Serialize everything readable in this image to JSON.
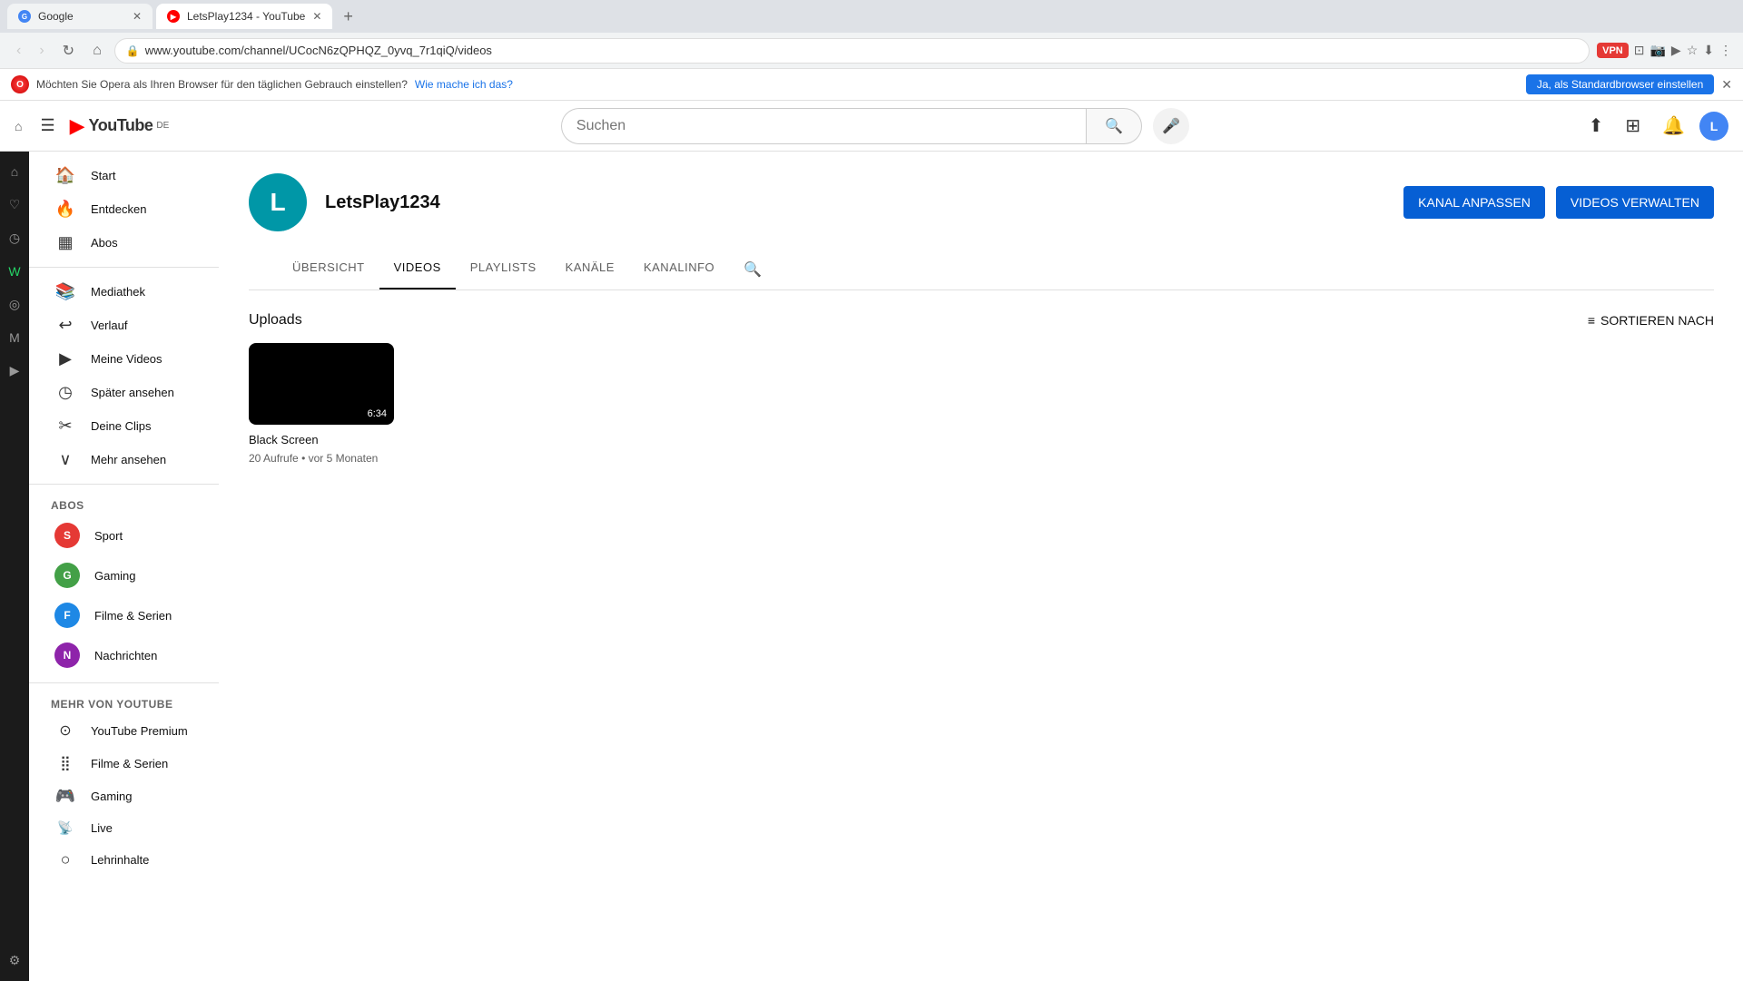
{
  "browser": {
    "tabs": [
      {
        "id": "google",
        "title": "Google",
        "favicon": "G",
        "favicon_type": "google",
        "active": false
      },
      {
        "id": "youtube",
        "title": "LetsPlay1234 - YouTube",
        "favicon": "YT",
        "favicon_type": "yt",
        "active": true
      }
    ],
    "new_tab_label": "+",
    "address": "www.youtube.com/channel/UCocN6zQPHQZ_0yvq_7r1qiQ/videos",
    "nav": {
      "back": "‹",
      "forward": "›",
      "refresh": "↻",
      "home": "⌂"
    }
  },
  "info_bar": {
    "message": "Möchten Sie Opera als Ihren Browser für den täglichen Gebrauch einstellen?",
    "link_text": "Wie mache ich das?",
    "cta": "Ja, als Standardbrowser einstellen",
    "close": "✕"
  },
  "youtube": {
    "logo_text": "YouTube",
    "logo_badge": "DE",
    "search_placeholder": "Suchen",
    "header_buttons": {
      "upload": "⬆",
      "apps": "⊞",
      "notifications": "🔔",
      "avatar_letter": "L"
    },
    "channel": {
      "avatar_letter": "L",
      "name": "LetsPlay1234",
      "btn_customize": "KANAL ANPASSEN",
      "btn_manage": "VIDEOS VERWALTEN",
      "tabs": [
        {
          "id": "ubersicht",
          "label": "ÜBERSICHT",
          "active": false
        },
        {
          "id": "videos",
          "label": "VIDEOS",
          "active": true
        },
        {
          "id": "playlists",
          "label": "PLAYLISTS",
          "active": false
        },
        {
          "id": "kanale",
          "label": "KANÄLE",
          "active": false
        },
        {
          "id": "kanalinfo",
          "label": "KANALINFO",
          "active": false
        }
      ]
    },
    "uploads": {
      "title": "Uploads",
      "sort_label": "SORTIEREN NACH",
      "videos": [
        {
          "id": "v1",
          "title": "Black Screen",
          "duration": "6:34",
          "views": "20 Aufrufe",
          "age": "vor 5 Monaten"
        }
      ]
    },
    "sidebar": {
      "main_items": [
        {
          "id": "start",
          "label": "Start",
          "icon": "🏠"
        },
        {
          "id": "entdecken",
          "label": "Entdecken",
          "icon": "🔥"
        },
        {
          "id": "abos",
          "label": "Abos",
          "icon": "▦"
        }
      ],
      "library_items": [
        {
          "id": "mediathek",
          "label": "Mediathek",
          "icon": "📚"
        },
        {
          "id": "verlauf",
          "label": "Verlauf",
          "icon": "↩"
        },
        {
          "id": "meine-videos",
          "label": "Meine Videos",
          "icon": "▶"
        },
        {
          "id": "spater",
          "label": "Später ansehen",
          "icon": "◷"
        },
        {
          "id": "clips",
          "label": "Deine Clips",
          "icon": "✂"
        }
      ],
      "mehr_label": "Mehr ansehen",
      "abos_section": "ABOS",
      "abos_items": [
        {
          "id": "sport",
          "label": "Sport",
          "color": "#e53935",
          "letter": "S"
        },
        {
          "id": "gaming",
          "label": "Gaming",
          "color": "#43a047",
          "letter": "G"
        },
        {
          "id": "filme",
          "label": "Filme & Serien",
          "color": "#1e88e5",
          "letter": "F"
        },
        {
          "id": "nachrichten",
          "label": "Nachrichten",
          "color": "#8e24aa",
          "letter": "N"
        }
      ],
      "mehr_von_section": "MEHR VON YOUTUBE",
      "mehr_von_items": [
        {
          "id": "yt-premium",
          "label": "YouTube Premium",
          "icon": "⊙"
        },
        {
          "id": "filme-serien",
          "label": "Filme & Serien",
          "icon": "⣿"
        },
        {
          "id": "gaming2",
          "label": "Gaming",
          "icon": "🎮"
        },
        {
          "id": "live",
          "label": "Live",
          "icon": "📡"
        },
        {
          "id": "lehrinhalte",
          "label": "Lehrinhalte",
          "icon": "○"
        }
      ]
    }
  },
  "opera_sidebar": {
    "items": [
      {
        "id": "home",
        "icon": "⌂"
      },
      {
        "id": "bookmarks",
        "icon": "♡"
      },
      {
        "id": "history",
        "icon": "◷"
      },
      {
        "id": "downloads",
        "icon": "⬇"
      },
      {
        "id": "whatsapp",
        "icon": "W"
      },
      {
        "id": "instagram",
        "icon": "◎"
      },
      {
        "id": "messenger",
        "icon": "M"
      },
      {
        "id": "player",
        "icon": "▶"
      },
      {
        "id": "settings",
        "icon": "⚙"
      }
    ]
  }
}
